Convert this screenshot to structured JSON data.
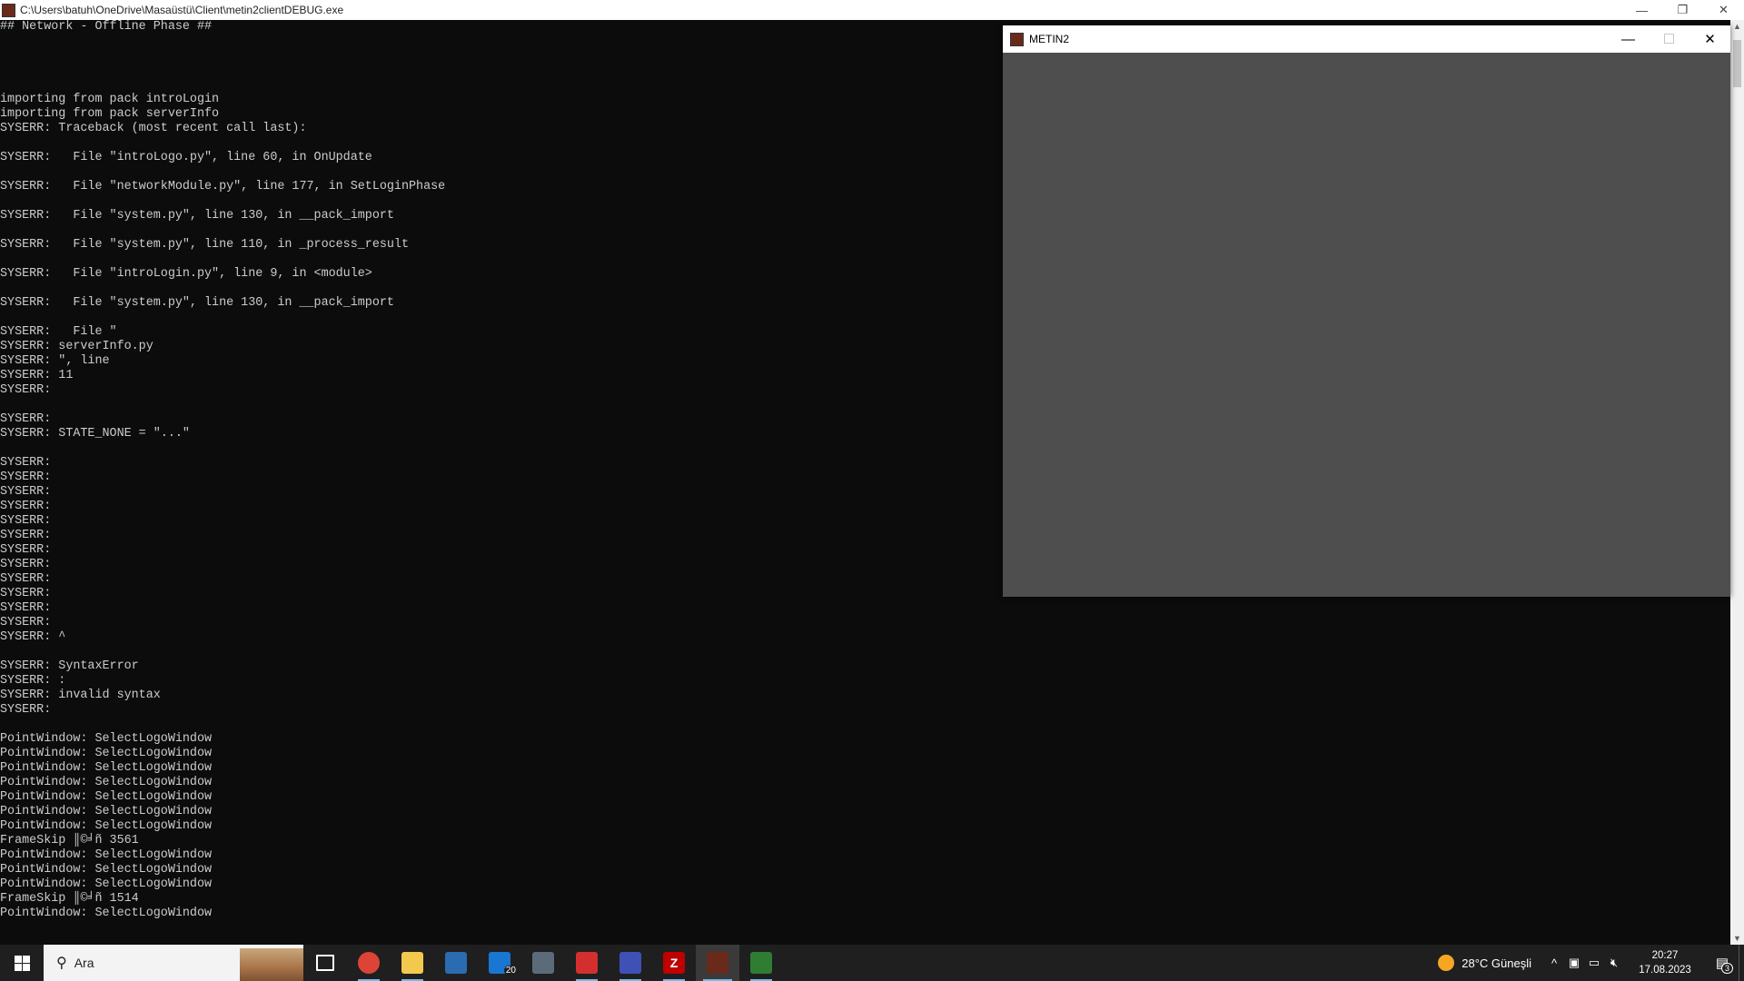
{
  "console": {
    "title": "C:\\Users\\batuh\\OneDrive\\Masaüstü\\Client\\metin2clientDEBUG.exe",
    "lines": [
      "## Network - Offline Phase ##",
      "",
      "",
      "",
      "",
      "importing from pack introLogin",
      "importing from pack serverInfo",
      "SYSERR: Traceback (most recent call last):",
      "",
      "SYSERR:   File \"introLogo.py\", line 60, in OnUpdate",
      "",
      "SYSERR:   File \"networkModule.py\", line 177, in SetLoginPhase",
      "",
      "SYSERR:   File \"system.py\", line 130, in __pack_import",
      "",
      "SYSERR:   File \"system.py\", line 110, in _process_result",
      "",
      "SYSERR:   File \"introLogin.py\", line 9, in <module>",
      "",
      "SYSERR:   File \"system.py\", line 130, in __pack_import",
      "",
      "SYSERR:   File \"",
      "SYSERR: serverInfo.py",
      "SYSERR: \", line",
      "SYSERR: 11",
      "SYSERR:",
      "",
      "SYSERR:",
      "SYSERR: STATE_NONE = \"...\"",
      "",
      "SYSERR:",
      "SYSERR:",
      "SYSERR:",
      "SYSERR:",
      "SYSERR:",
      "SYSERR:",
      "SYSERR:",
      "SYSERR:",
      "SYSERR:",
      "SYSERR:",
      "SYSERR:",
      "SYSERR:",
      "SYSERR: ^",
      "",
      "SYSERR: SyntaxError",
      "SYSERR: :",
      "SYSERR: invalid syntax",
      "SYSERR:",
      "",
      "PointWindow: SelectLogoWindow",
      "PointWindow: SelectLogoWindow",
      "PointWindow: SelectLogoWindow",
      "PointWindow: SelectLogoWindow",
      "PointWindow: SelectLogoWindow",
      "PointWindow: SelectLogoWindow",
      "PointWindow: SelectLogoWindow",
      "FrameSkip ║©╛ñ 3561",
      "PointWindow: SelectLogoWindow",
      "PointWindow: SelectLogoWindow",
      "PointWindow: SelectLogoWindow",
      "FrameSkip ║©╛ñ 1514",
      "PointWindow: SelectLogoWindow"
    ]
  },
  "window_controls": {
    "minimize": "—",
    "maximize": "☐",
    "restore": "❐",
    "close": "✕"
  },
  "metin_window": {
    "title": "METIN2"
  },
  "taskbar": {
    "search_placeholder": "Ara",
    "apps": [
      {
        "name": "chrome",
        "glyph": "",
        "color": "#db4437"
      },
      {
        "name": "file-explorer",
        "glyph": "",
        "color": "#f2c94c"
      },
      {
        "name": "store",
        "glyph": "",
        "color": "#2b6cb0"
      },
      {
        "name": "mail",
        "glyph": "",
        "color": "#1976d2",
        "badge": "20"
      },
      {
        "name": "calculator",
        "glyph": "",
        "color": "#5b6b7a"
      },
      {
        "name": "pdf-reader",
        "glyph": "",
        "color": "#d32f2f"
      },
      {
        "name": "network-tool",
        "glyph": "",
        "color": "#3f51b5"
      },
      {
        "name": "filezilla",
        "glyph": "Z",
        "color": "#bf0000"
      },
      {
        "name": "metin2",
        "glyph": "",
        "color": "#6a2a1a"
      },
      {
        "name": "task-monitor",
        "glyph": "",
        "color": "#2e7d32"
      }
    ],
    "weather_text": "28°C  Güneşli",
    "time": "20:27",
    "date": "17.08.2023",
    "notification_count": "3"
  },
  "colors": {
    "console_bg": "#0c0c0c",
    "console_text": "#cccccc",
    "metin_client_bg": "#4e4e4e",
    "taskbar_bg": "#1f1f1f",
    "accent": "#76b9ed"
  }
}
